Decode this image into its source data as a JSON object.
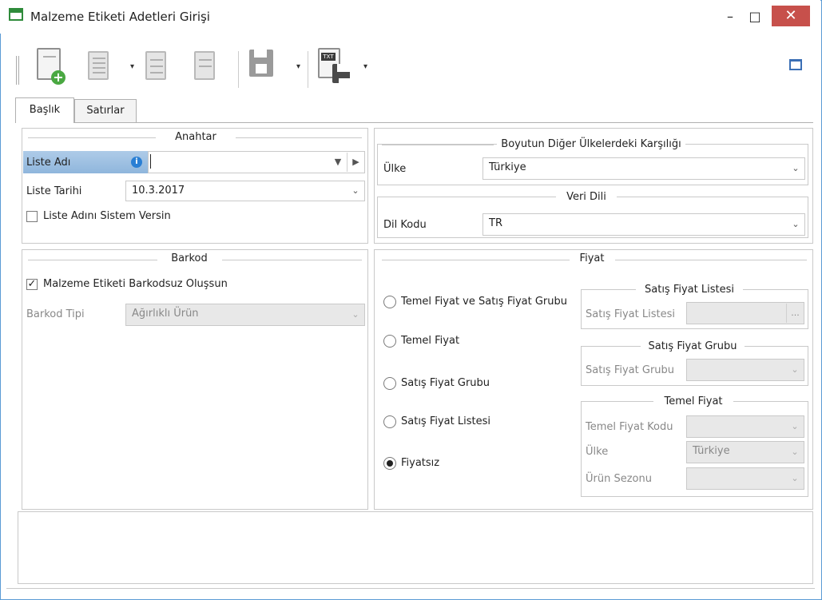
{
  "window": {
    "title": "Malzeme Etiketi Adetleri Girişi",
    "minimize": "–",
    "maximize": "□",
    "close": "✕"
  },
  "tabs": [
    {
      "label": "Başlık"
    },
    {
      "label": "Satırlar"
    }
  ],
  "anahtar": {
    "legend": "Anahtar",
    "liste_adi_label": "Liste Adı",
    "liste_adi_value": "",
    "liste_tarihi_label": "Liste Tarihi",
    "liste_tarihi_value": "10.3.2017",
    "sistem_versin_label": "Liste Adını Sistem Versin"
  },
  "boyut": {
    "legend": "Boyutun Diğer Ülkelerdeki Karşılığı",
    "ulke_label": "Ülke",
    "ulke_value": "Türkiye"
  },
  "veri_dili": {
    "legend": "Veri Dili",
    "dil_kodu_label": "Dil Kodu",
    "dil_kodu_value": "TR"
  },
  "barkod": {
    "legend": "Barkod",
    "checkbox_label": "Malzeme Etiketi Barkodsuz Oluşsun",
    "tipi_label": "Barkod Tipi",
    "tipi_value": "Ağırlıklı Ürün"
  },
  "fiyat": {
    "legend": "Fiyat",
    "options": [
      {
        "label": "Temel Fiyat ve Satış Fiyat Grubu"
      },
      {
        "label": "Temel Fiyat"
      },
      {
        "label": "Satış Fiyat Grubu"
      },
      {
        "label": "Satış Fiyat Listesi"
      },
      {
        "label": "Fiyatsız"
      }
    ],
    "sfl_legend": "Satış Fiyat Listesi",
    "sfl_label": "Satış Fiyat Listesi",
    "sfl_button": "...",
    "sfg_legend": "Satış Fiyat Grubu",
    "sfg_label": "Satış Fiyat Grubu",
    "tf_legend": "Temel Fiyat",
    "tf_kodu_label": "Temel Fiyat Kodu",
    "tf_ulke_label": "Ülke",
    "tf_ulke_value": "Türkiye",
    "tf_sezon_label": "Ürün Sezonu"
  },
  "toolbar": {
    "save_txt_badge": "TXT"
  },
  "colors": {
    "accent": "#5b9bd5",
    "close": "#c7504b",
    "highlight": "#9dc0e3",
    "add_green": "#4aa842"
  }
}
